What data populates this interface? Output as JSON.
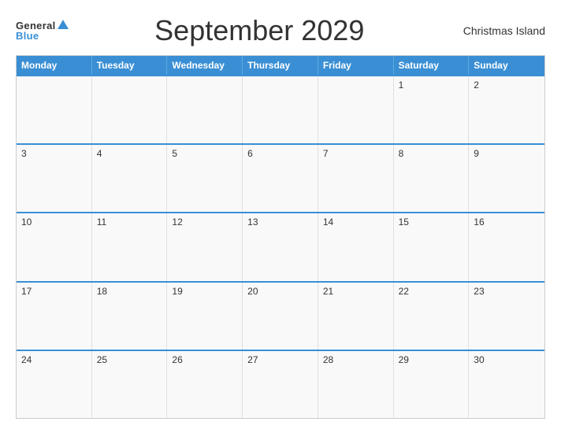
{
  "header": {
    "title": "September 2029",
    "location": "Christmas Island",
    "logo_general": "General",
    "logo_blue": "Blue"
  },
  "calendar": {
    "days_of_week": [
      "Monday",
      "Tuesday",
      "Wednesday",
      "Thursday",
      "Friday",
      "Saturday",
      "Sunday"
    ],
    "rows": [
      [
        {
          "day": "",
          "empty": true
        },
        {
          "day": "",
          "empty": true
        },
        {
          "day": "",
          "empty": true
        },
        {
          "day": "",
          "empty": true
        },
        {
          "day": "",
          "empty": true
        },
        {
          "day": "1",
          "empty": false
        },
        {
          "day": "2",
          "empty": false
        }
      ],
      [
        {
          "day": "3",
          "empty": false
        },
        {
          "day": "4",
          "empty": false
        },
        {
          "day": "5",
          "empty": false
        },
        {
          "day": "6",
          "empty": false
        },
        {
          "day": "7",
          "empty": false
        },
        {
          "day": "8",
          "empty": false
        },
        {
          "day": "9",
          "empty": false
        }
      ],
      [
        {
          "day": "10",
          "empty": false
        },
        {
          "day": "11",
          "empty": false
        },
        {
          "day": "12",
          "empty": false
        },
        {
          "day": "13",
          "empty": false
        },
        {
          "day": "14",
          "empty": false
        },
        {
          "day": "15",
          "empty": false
        },
        {
          "day": "16",
          "empty": false
        }
      ],
      [
        {
          "day": "17",
          "empty": false
        },
        {
          "day": "18",
          "empty": false
        },
        {
          "day": "19",
          "empty": false
        },
        {
          "day": "20",
          "empty": false
        },
        {
          "day": "21",
          "empty": false
        },
        {
          "day": "22",
          "empty": false
        },
        {
          "day": "23",
          "empty": false
        }
      ],
      [
        {
          "day": "24",
          "empty": false
        },
        {
          "day": "25",
          "empty": false
        },
        {
          "day": "26",
          "empty": false
        },
        {
          "day": "27",
          "empty": false
        },
        {
          "day": "28",
          "empty": false
        },
        {
          "day": "29",
          "empty": false
        },
        {
          "day": "30",
          "empty": false
        }
      ]
    ]
  }
}
